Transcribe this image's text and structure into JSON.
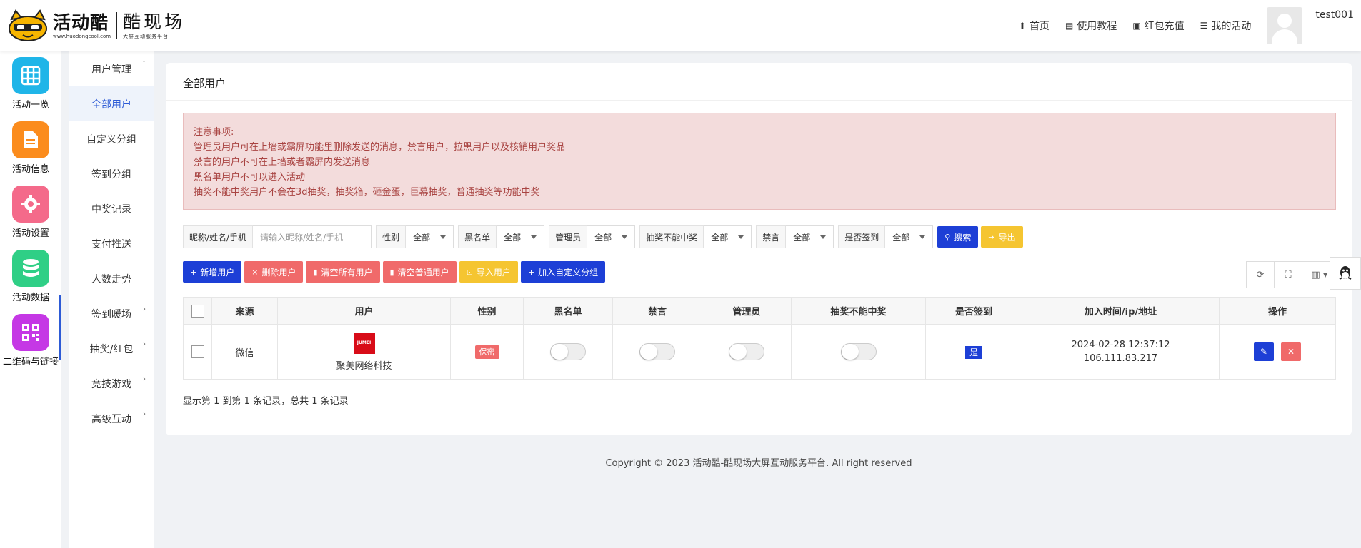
{
  "header": {
    "brand_cn": "活动酷",
    "brand_url": "www.huodongcool.com",
    "sub_brand": "酷现场",
    "sub_slogan": "大屏互动服务平台",
    "nav": [
      {
        "label": "首页",
        "icon": "home-icon"
      },
      {
        "label": "使用教程",
        "icon": "doc-icon"
      },
      {
        "label": "红包充值",
        "icon": "wallet-icon"
      },
      {
        "label": "我的活动",
        "icon": "list-icon"
      }
    ],
    "username": "test001"
  },
  "iconbar": [
    {
      "label": "活动一览",
      "icon": "grid-icon",
      "color": "#1fb5e8"
    },
    {
      "label": "活动信息",
      "icon": "document-icon",
      "color": "#fb8c1d"
    },
    {
      "label": "活动设置",
      "icon": "gear-icon",
      "color": "#f46a8a"
    },
    {
      "label": "活动数据",
      "icon": "database-icon",
      "color": "#2fcf86"
    },
    {
      "label": "二维码与链接",
      "icon": "qrcode-icon",
      "color": "#c538e5"
    }
  ],
  "submenu": [
    {
      "label": "用户管理",
      "arrow": "ˇ"
    },
    {
      "label": "全部用户",
      "active": true
    },
    {
      "label": "自定义分组"
    },
    {
      "label": "签到分组"
    },
    {
      "label": "中奖记录"
    },
    {
      "label": "支付推送"
    },
    {
      "label": "人数走势"
    },
    {
      "label": "签到暖场",
      "arrow": "›"
    },
    {
      "label": "抽奖/红包",
      "arrow": "›"
    },
    {
      "label": "竞技游戏",
      "arrow": "›"
    },
    {
      "label": "高级互动",
      "arrow": "›"
    }
  ],
  "card": {
    "title": "全部用户",
    "notice": [
      "注意事项:",
      "管理员用户可在上墙或霸屏功能里删除发送的消息，禁言用户，拉黑用户以及核销用户奖品",
      "禁言的用户不可在上墙或者霸屏内发送消息",
      "黑名单用户不可以进入活动",
      "抽奖不能中奖用户不会在3d抽奖，抽奖箱，砸金蛋，巨幕抽奖，普通抽奖等功能中奖"
    ],
    "filters": {
      "name_label": "昵称/姓名/手机",
      "name_placeholder": "请输入昵称/姓名/手机",
      "selects": [
        {
          "label": "性别",
          "value": "全部"
        },
        {
          "label": "黑名单",
          "value": "全部"
        },
        {
          "label": "管理员",
          "value": "全部"
        },
        {
          "label": "抽奖不能中奖",
          "value": "全部"
        },
        {
          "label": "禁言",
          "value": "全部"
        },
        {
          "label": "是否签到",
          "value": "全部"
        }
      ],
      "search_btn": "搜索",
      "export_btn": "导出"
    },
    "actions": [
      {
        "label": "新增用户",
        "icon": "+",
        "color": "blue"
      },
      {
        "label": "删除用户",
        "icon": "×",
        "color": "red"
      },
      {
        "label": "清空所有用户",
        "icon": "🗑",
        "color": "red"
      },
      {
        "label": "清空普通用户",
        "icon": "🗑",
        "color": "red"
      },
      {
        "label": "导入用户",
        "icon": "⊡",
        "color": "yellow"
      },
      {
        "label": "加入自定义分组",
        "icon": "+",
        "color": "blue"
      }
    ],
    "table": {
      "headers": [
        "来源",
        "用户",
        "性别",
        "黑名单",
        "禁言",
        "管理员",
        "抽奖不能中奖",
        "是否签到",
        "加入时间/ip/地址",
        "操作"
      ],
      "rows": [
        {
          "source": "微信",
          "user_logo": "JUMEI",
          "user_name": "聚美网络科技",
          "gender": "保密",
          "blacklist": false,
          "muted": false,
          "admin": false,
          "no_win": false,
          "signed": "是",
          "time": "2024-02-28 12:37:12",
          "ip": "106.111.83.217"
        }
      ]
    },
    "pager": "显示第 1 到第 1 条记录，总共 1 条记录"
  },
  "footer": "Copyright © 2023 活动酷-酷现场大屏互动服务平台. All right reserved",
  "colors": {
    "primary": "#1d3fd6",
    "danger": "#f06a6a",
    "warning": "#f5c531",
    "notice_bg": "#f3dcdc"
  }
}
